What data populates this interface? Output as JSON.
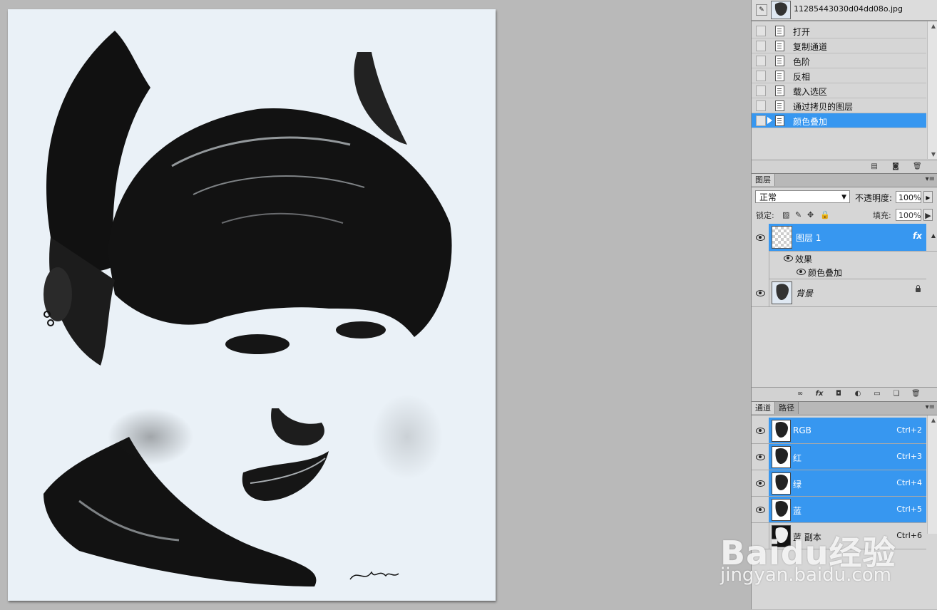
{
  "history": {
    "snapshot_name": "11285443030d04dd08o.jpg",
    "steps": [
      {
        "label": "打开",
        "selected": false
      },
      {
        "label": "复制通道",
        "selected": false
      },
      {
        "label": "色阶",
        "selected": false
      },
      {
        "label": "反相",
        "selected": false
      },
      {
        "label": "载入选区",
        "selected": false
      },
      {
        "label": "通过拷贝的图层",
        "selected": false
      },
      {
        "label": "颜色叠加",
        "selected": true
      }
    ]
  },
  "layers": {
    "tab_label": "图层",
    "blend_mode": "正常",
    "opacity_label": "不透明度:",
    "opacity_value": "100%",
    "lock_label": "锁定:",
    "fill_label": "填充:",
    "fill_value": "100%",
    "items": [
      {
        "name": "图层 1",
        "selected": true,
        "fx": "fx",
        "effects_label": "效果",
        "effect_name": "颜色叠加"
      },
      {
        "name": "背景",
        "selected": false,
        "locked": true
      }
    ]
  },
  "channels": {
    "tabs": [
      "通道",
      "路径"
    ],
    "items": [
      {
        "name": "RGB",
        "shortcut": "Ctrl+2",
        "selected": true,
        "visible": true
      },
      {
        "name": "红",
        "shortcut": "Ctrl+3",
        "selected": true,
        "visible": true
      },
      {
        "name": "绿",
        "shortcut": "Ctrl+4",
        "selected": true,
        "visible": true
      },
      {
        "name": "蓝",
        "shortcut": "Ctrl+5",
        "selected": true,
        "visible": true
      },
      {
        "name": "蓝 副本",
        "shortcut": "Ctrl+6",
        "selected": false,
        "visible": false
      }
    ]
  },
  "watermark": {
    "logo": "Baidu经验",
    "url": "jingyan.baidu.com"
  },
  "colors": {
    "selection": "#3797f0",
    "panel_bg": "#d6d6d6",
    "workspace": "#b9b9b9",
    "paper": "#eaf1f7"
  },
  "icons": [
    "history-brush-icon",
    "document-icon",
    "eye-icon",
    "lock-icon",
    "fx-icon",
    "link-icon",
    "mask-icon",
    "adjustment-icon",
    "folder-icon",
    "new-layer-icon",
    "trash-icon",
    "camera-icon"
  ]
}
